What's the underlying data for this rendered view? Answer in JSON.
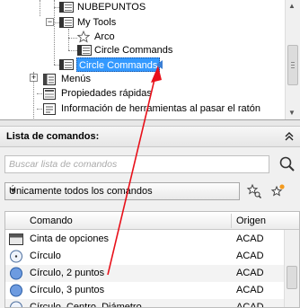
{
  "tree": {
    "items": [
      {
        "label": "NUBEPUNTOS",
        "icon": "table-icon"
      },
      {
        "label": "My Tools",
        "icon": "table-icon"
      },
      {
        "label": "Arco",
        "icon": "star-icon"
      },
      {
        "label": "Circle Commands",
        "icon": "table-icon"
      },
      {
        "label": "Circle Commands",
        "icon": "table-icon",
        "selected": true
      },
      {
        "label": "Menús",
        "icon": "menu-icon"
      },
      {
        "label": "Propiedades rápidas",
        "icon": "properties-icon"
      },
      {
        "label": "Información de herramientas al pasar el ratón",
        "icon": "tooltip-icon"
      }
    ]
  },
  "panel": {
    "title": "Lista de comandos:",
    "search_placeholder": "Buscar lista de comandos",
    "filter_value": "Únicamente todos los comandos",
    "columns": {
      "command": "Comando",
      "origin": "Origen"
    },
    "rows": [
      {
        "name": "Cinta de opciones",
        "origin": "ACAD",
        "icon": "ribbon-icon"
      },
      {
        "name": "Círculo",
        "origin": "ACAD",
        "icon": "circle-icon"
      },
      {
        "name": "Círculo, 2 puntos",
        "origin": "ACAD",
        "icon": "circle-icon"
      },
      {
        "name": "Círculo, 3 puntos",
        "origin": "ACAD",
        "icon": "circle-icon"
      },
      {
        "name": "Círculo, Centro, Diámetro",
        "origin": "ACAD",
        "icon": "circle-icon"
      }
    ]
  },
  "colors": {
    "selection": "#3399ff",
    "drag_arrow": "#e8101a",
    "drop_marker": "#3a7fd5"
  }
}
